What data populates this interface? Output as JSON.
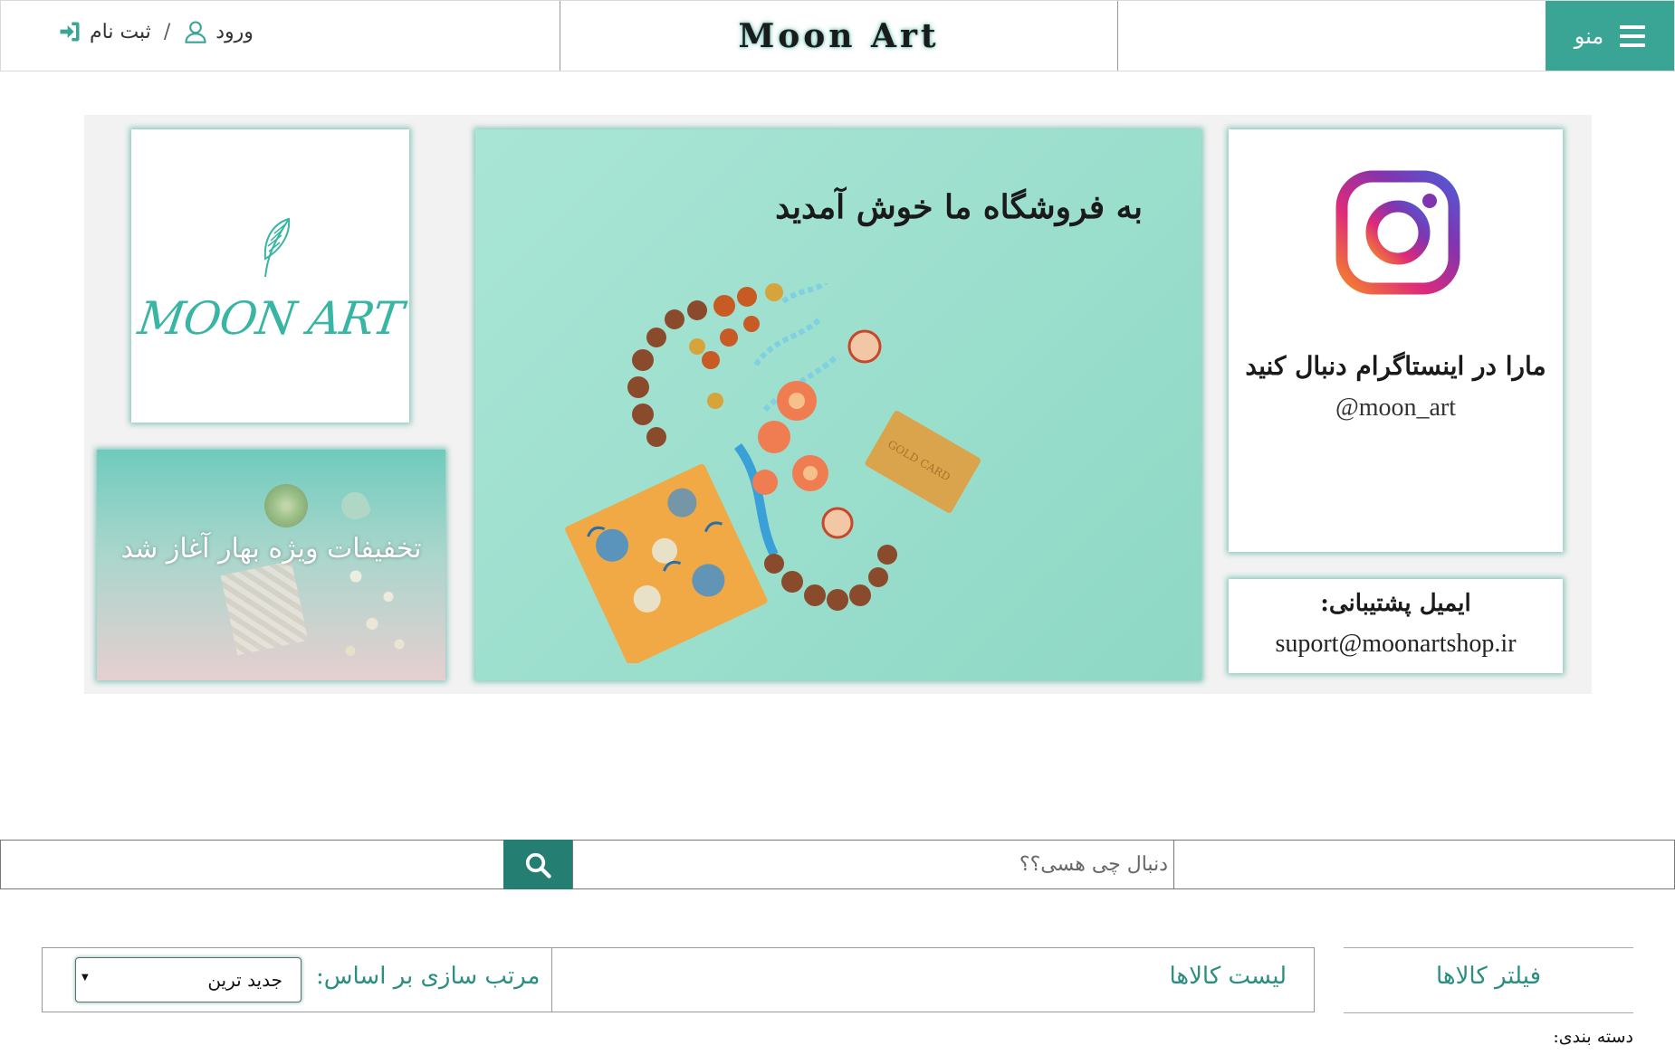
{
  "header": {
    "site_title": "Moon Art",
    "menu_label": "منو",
    "login_label": "ورود",
    "separator": "/",
    "register_label": "ثبت نام"
  },
  "hero": {
    "logo_text": "MOON ART",
    "welcome_text": "به فروشگاه ما خوش آمدید",
    "card_text": "GOLD CARD",
    "promo_text": "تخفیفات ویژه بهار آغاز شد",
    "instagram_text": "مارا در اینستاگرام دنبال کنید",
    "instagram_handle": "@moon_art",
    "support_label": "ایمیل پشتیبانی:",
    "support_email": "suport@moonartshop.ir"
  },
  "search": {
    "placeholder": "دنبال چی هسی؟؟"
  },
  "products": {
    "list_title": "لیست کالاها",
    "sort_label": "مرتب سازی بر اساس:",
    "sort_selected": "جدید ترین",
    "filter_title": "فیلتر کالاها",
    "category_label": "دسته بندی:"
  },
  "colors": {
    "accent": "#3aa595",
    "search_button": "#257e72",
    "teal_text": "#2a8e80"
  },
  "icons": [
    "hamburger-icon",
    "user-icon",
    "sign-in-icon",
    "instagram-icon",
    "search-icon",
    "leaf-icon",
    "dropdown-arrow-icon"
  ]
}
